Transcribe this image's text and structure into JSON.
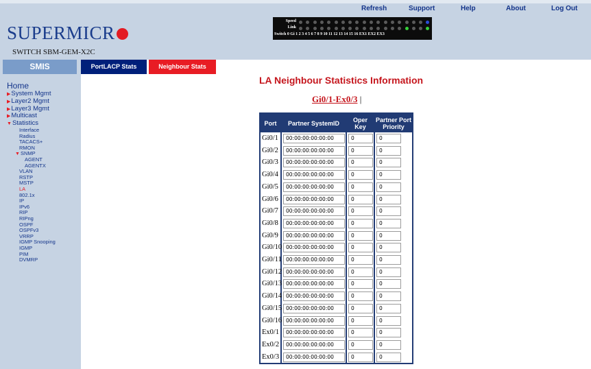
{
  "brand": {
    "logo_text": "SUPERMICR",
    "model": "SWITCH SBM-GEM-X2C"
  },
  "topnav": [
    "Refresh",
    "Support",
    "Help",
    "About",
    "Log Out"
  ],
  "panel": {
    "speed_label": "Speed",
    "link_label": "Link",
    "ports_label": "Switch 0 Gi  1  2  3  4  5  6  7  8  9 10 11 12 13 14 15 16 EX1 EX2 EX3"
  },
  "sidebar": {
    "tab_label": "SMIS",
    "home": "Home",
    "items": [
      {
        "label": "System Mgmt",
        "level": "top",
        "arrow": "right"
      },
      {
        "label": "Layer2 Mgmt",
        "level": "top",
        "arrow": "right"
      },
      {
        "label": "Layer3 Mgmt",
        "level": "top",
        "arrow": "right"
      },
      {
        "label": "Multicast",
        "level": "top",
        "arrow": "right"
      },
      {
        "label": "Statistics",
        "level": "top",
        "arrow": "down"
      },
      {
        "label": "Interface",
        "level": "sub"
      },
      {
        "label": "Radius",
        "level": "sub"
      },
      {
        "label": "TACACS+",
        "level": "sub"
      },
      {
        "label": "RMON",
        "level": "sub"
      },
      {
        "label": "SNMP",
        "level": "snmp",
        "arrow": "down"
      },
      {
        "label": "AGENT",
        "level": "subsub"
      },
      {
        "label": "AGENTX",
        "level": "subsub"
      },
      {
        "label": "VLAN",
        "level": "sub"
      },
      {
        "label": "RSTP",
        "level": "sub"
      },
      {
        "label": "MSTP",
        "level": "sub"
      },
      {
        "label": "LA",
        "level": "sub",
        "active": true
      },
      {
        "label": "802.1x",
        "level": "sub"
      },
      {
        "label": "IP",
        "level": "sub"
      },
      {
        "label": "IPv6",
        "level": "sub"
      },
      {
        "label": "RIP",
        "level": "sub"
      },
      {
        "label": "RIPng",
        "level": "sub"
      },
      {
        "label": "OSPF",
        "level": "sub"
      },
      {
        "label": "OSPFv3",
        "level": "sub"
      },
      {
        "label": "VRRP",
        "level": "sub"
      },
      {
        "label": "IGMP Snooping",
        "level": "sub"
      },
      {
        "label": "IGMP",
        "level": "sub"
      },
      {
        "label": "PIM",
        "level": "sub"
      },
      {
        "label": "DVMRP",
        "level": "sub"
      }
    ]
  },
  "tabs": {
    "portlacp": "PortLACP Stats",
    "neighbour": "Neighbour Stats"
  },
  "main": {
    "title": "LA Neighbour Statistics Information",
    "port_range_link": "Gi0/1-Ex0/3",
    "port_range_sep": "|"
  },
  "table": {
    "headers": [
      "Port",
      "Partner SystemID",
      "Oper Key",
      "Partner Port Priority"
    ],
    "rows": [
      {
        "port": "Gi0/1",
        "system_id": "00:00:00:00:00:00",
        "oper_key": "0",
        "priority": "0"
      },
      {
        "port": "Gi0/2",
        "system_id": "00:00:00:00:00:00",
        "oper_key": "0",
        "priority": "0"
      },
      {
        "port": "Gi0/3",
        "system_id": "00:00:00:00:00:00",
        "oper_key": "0",
        "priority": "0"
      },
      {
        "port": "Gi0/4",
        "system_id": "00:00:00:00:00:00",
        "oper_key": "0",
        "priority": "0"
      },
      {
        "port": "Gi0/5",
        "system_id": "00:00:00:00:00:00",
        "oper_key": "0",
        "priority": "0"
      },
      {
        "port": "Gi0/6",
        "system_id": "00:00:00:00:00:00",
        "oper_key": "0",
        "priority": "0"
      },
      {
        "port": "Gi0/7",
        "system_id": "00:00:00:00:00:00",
        "oper_key": "0",
        "priority": "0"
      },
      {
        "port": "Gi0/8",
        "system_id": "00:00:00:00:00:00",
        "oper_key": "0",
        "priority": "0"
      },
      {
        "port": "Gi0/9",
        "system_id": "00:00:00:00:00:00",
        "oper_key": "0",
        "priority": "0"
      },
      {
        "port": "Gi0/10",
        "system_id": "00:00:00:00:00:00",
        "oper_key": "0",
        "priority": "0"
      },
      {
        "port": "Gi0/11",
        "system_id": "00:00:00:00:00:00",
        "oper_key": "0",
        "priority": "0"
      },
      {
        "port": "Gi0/12",
        "system_id": "00:00:00:00:00:00",
        "oper_key": "0",
        "priority": "0"
      },
      {
        "port": "Gi0/13",
        "system_id": "00:00:00:00:00:00",
        "oper_key": "0",
        "priority": "0"
      },
      {
        "port": "Gi0/14",
        "system_id": "00:00:00:00:00:00",
        "oper_key": "0",
        "priority": "0"
      },
      {
        "port": "Gi0/15",
        "system_id": "00:00:00:00:00:00",
        "oper_key": "0",
        "priority": "0"
      },
      {
        "port": "Gi0/16",
        "system_id": "00:00:00:00:00:00",
        "oper_key": "0",
        "priority": "0"
      },
      {
        "port": "Ex0/1",
        "system_id": "00:00:00:00:00:00",
        "oper_key": "0",
        "priority": "0"
      },
      {
        "port": "Ex0/2",
        "system_id": "00:00:00:00:00:00",
        "oper_key": "0",
        "priority": "0"
      },
      {
        "port": "Ex0/3",
        "system_id": "00:00:00:00:00:00",
        "oper_key": "0",
        "priority": "0"
      }
    ]
  },
  "colors": {
    "header_bg": "#c6d3e3",
    "table_header": "#213b74",
    "accent_red": "#e81c24",
    "nav_blue": "#13348a"
  }
}
